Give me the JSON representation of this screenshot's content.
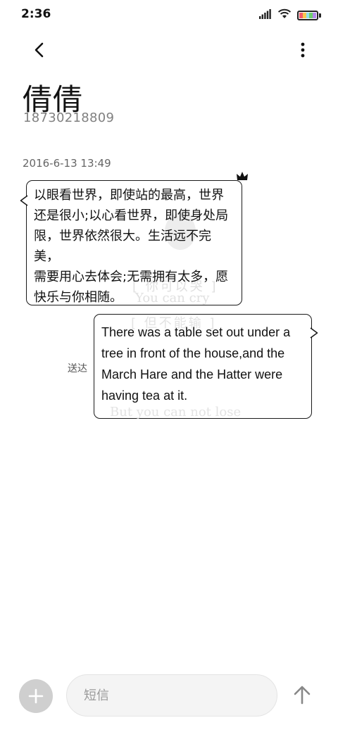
{
  "status_bar": {
    "time": "2:36",
    "icons": [
      "signal-icon",
      "wifi-icon",
      "battery-icon"
    ],
    "battery_colors": [
      "#f25c6b",
      "#f9c74f",
      "#90e0ef",
      "#6ecf6e",
      "#b388eb"
    ]
  },
  "header": {
    "back_icon": "chevron-left-icon",
    "more_icon": "more-vert-icon"
  },
  "contact": {
    "name": "倩倩",
    "number": "18730218809"
  },
  "conversation": {
    "timestamp": "2016-6-13 13:49",
    "incoming": {
      "text": "以眼看世界，即使站的最高，世界\n还是很小;以心看世界，即使身处局\n限，世界依然很大。生活远不完美，\n需要用心去体会;无需拥有太多，愿\n快乐与你相随。",
      "watermark_cn": "[ 你可以哭 ]",
      "watermark_en": "You can cry"
    },
    "outgoing": {
      "text": "There was a table set out under a tree in front of the house,and the March Hare and the Hatter were having tea at it.",
      "watermark_cn": "[ 但不能输 ]",
      "watermark_en": "But you can not lose",
      "status": "送达"
    }
  },
  "composer": {
    "add_icon": "plus-icon",
    "placeholder": "短信",
    "send_icon": "arrow-up-icon"
  }
}
